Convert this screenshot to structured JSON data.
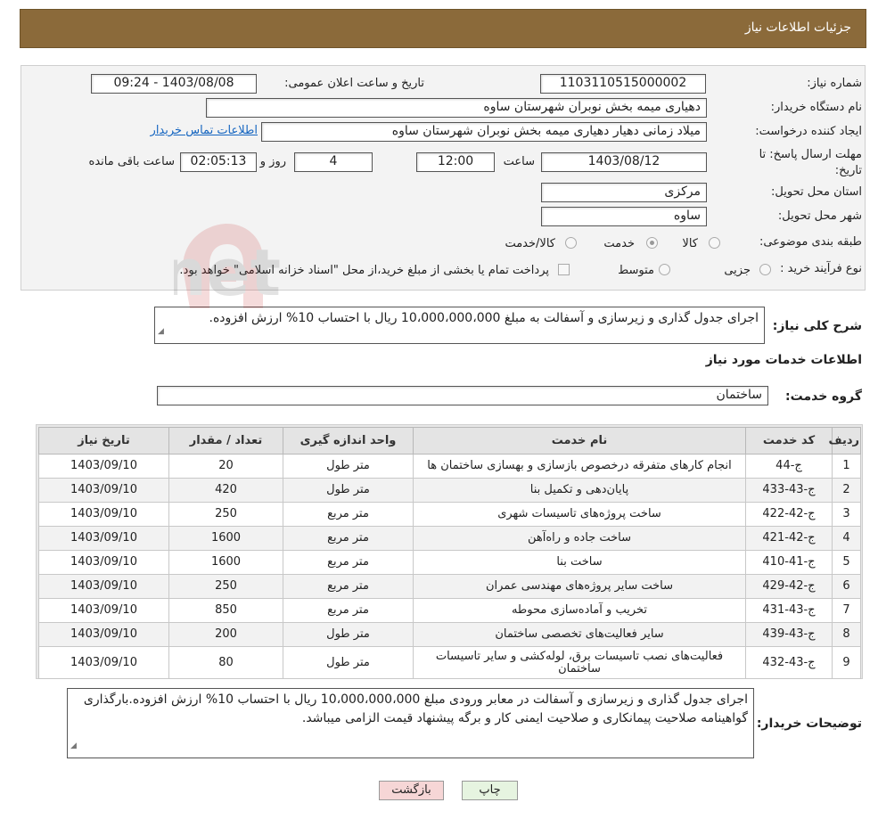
{
  "header": {
    "title": "جزئیات اطلاعات نیاز"
  },
  "form": {
    "need_number_label": "شماره نیاز:",
    "need_number": "1103110515000002",
    "announce_label": "تاریخ و ساعت اعلان عمومی:",
    "announce_value": "1403/08/08 - 09:24",
    "buyer_org_label": "نام دستگاه خریدار:",
    "buyer_org": "دهیاری میمه بخش نوبران شهرستان ساوه",
    "creator_label": "ایجاد کننده درخواست:",
    "creator": "میلاد زمانی دهیار دهیاری میمه بخش نوبران شهرستان ساوه",
    "contact_link": "اطلاعات تماس خریدار",
    "deadline_label_1": "مهلت ارسال پاسخ: تا",
    "deadline_label_2": "تاریخ:",
    "deadline_date": "1403/08/12",
    "time_label": "ساعت",
    "deadline_time": "12:00",
    "days_value": "4",
    "days_label": "روز و",
    "remaining_time": "02:05:13",
    "remaining_label": "ساعت باقی مانده",
    "province_label": "استان محل تحویل:",
    "province": "مرکزی",
    "city_label": "شهر محل تحویل:",
    "city": "ساوه",
    "category_label": "طبقه بندی موضوعی:",
    "category_options": [
      "کالا",
      "خدمت",
      "کالا/خدمت"
    ],
    "category_selected": "خدمت",
    "process_label": "نوع فرآیند خرید :",
    "process_options": [
      "جزیی",
      "متوسط"
    ],
    "process_note": "پرداخت تمام یا بخشی از مبلغ خرید،از محل \"اسناد خزانه اسلامی\" خواهد بود."
  },
  "description": {
    "label": "شرح کلی نیاز:",
    "text": "اجرای جدول گذاری و زیرسازی و آسفالت به مبلغ 10،000،000،000 ریال با احتساب 10% ارزش افزوده."
  },
  "services": {
    "section_title": "اطلاعات خدمات مورد نیاز",
    "group_label": "گروه خدمت:",
    "group_value": "ساختمان",
    "columns": [
      "ردیف",
      "کد خدمت",
      "نام خدمت",
      "واحد اندازه گیری",
      "تعداد / مقدار",
      "تاریخ نیاز"
    ],
    "rows": [
      [
        "1",
        "ج-44",
        "انجام کارهای متفرقه درخصوص بازسازی و بهسازی ساختمان ها",
        "متر طول",
        "20",
        "1403/09/10"
      ],
      [
        "2",
        "ج-43-433",
        "پایان‌دهی و تکمیل بنا",
        "متر طول",
        "420",
        "1403/09/10"
      ],
      [
        "3",
        "ج-42-422",
        "ساخت پروژه‌های تاسیسات شهری",
        "متر مربع",
        "250",
        "1403/09/10"
      ],
      [
        "4",
        "ج-42-421",
        "ساخت جاده و راه‌آهن",
        "متر مربع",
        "1600",
        "1403/09/10"
      ],
      [
        "5",
        "ج-41-410",
        "ساخت بنا",
        "متر مربع",
        "1600",
        "1403/09/10"
      ],
      [
        "6",
        "ج-42-429",
        "ساخت سایر پروژه‌های مهندسی عمران",
        "متر مربع",
        "250",
        "1403/09/10"
      ],
      [
        "7",
        "ج-43-431",
        "تخریب و آماده‌سازی محوطه",
        "متر مربع",
        "850",
        "1403/09/10"
      ],
      [
        "8",
        "ج-43-439",
        "سایر فعالیت‌های تخصصی ساختمان",
        "متر طول",
        "200",
        "1403/09/10"
      ],
      [
        "9",
        "ج-43-432",
        "فعالیت‌های نصب تاسیسات برق، لوله‌کشی و سایر تاسیسات ساختمان",
        "متر طول",
        "80",
        "1403/09/10"
      ]
    ]
  },
  "buyer_notes": {
    "label": "توضیحات خریدار:",
    "text": "اجرای جدول گذاری و زیرسازی و آسفالت در معابر ورودی مبلغ 10،000،000،000 ریال با احتساب 10% ارزش افزوده.بارگذاری گواهینامه صلاحیت پیمانکاری و صلاحیت ایمنی کار و برگه پیشنهاد قیمت الزامی میباشد."
  },
  "buttons": {
    "print": "چاپ",
    "back": "بازگشت"
  },
  "watermark": "AriaTender.net",
  "colors": {
    "header_bg": "#8b6a3a",
    "link": "#1565c0",
    "back_btn": "#f6d6d6",
    "print_btn": "#e6f4e0"
  }
}
